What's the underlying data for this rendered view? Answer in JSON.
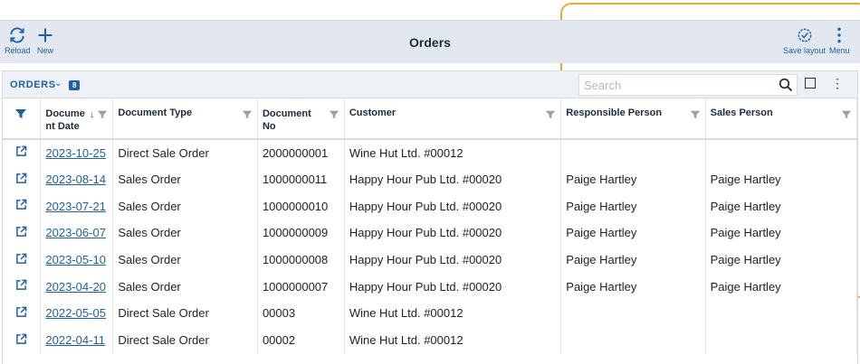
{
  "toolbar": {
    "reload_label": "Reload",
    "new_label": "New",
    "title": "Orders",
    "save_layout_label": "Save layout",
    "menu_label": "Menu"
  },
  "panel": {
    "label": "ORDERS",
    "count": "8",
    "search_placeholder": "Search"
  },
  "columns": [
    "Docume nt Date",
    "Document Type",
    "Document No",
    "Customer",
    "Responsible Person",
    "Sales Person"
  ],
  "rows": [
    {
      "date": "2023-10-25",
      "type": "Direct Sale Order",
      "no": "2000000001",
      "customer": "Wine Hut Ltd. #00012",
      "responsible": "",
      "sales": ""
    },
    {
      "date": "2023-08-14",
      "type": "Sales Order",
      "no": "1000000011",
      "customer": "Happy Hour Pub Ltd. #00020",
      "responsible": "Paige Hartley",
      "sales": "Paige Hartley"
    },
    {
      "date": "2023-07-21",
      "type": "Sales Order",
      "no": "1000000010",
      "customer": "Happy Hour Pub Ltd. #00020",
      "responsible": "Paige Hartley",
      "sales": "Paige Hartley"
    },
    {
      "date": "2023-06-07",
      "type": "Sales Order",
      "no": "1000000009",
      "customer": "Happy Hour Pub Ltd. #00020",
      "responsible": "Paige Hartley",
      "sales": "Paige Hartley"
    },
    {
      "date": "2023-05-10",
      "type": "Sales Order",
      "no": "1000000008",
      "customer": "Happy Hour Pub Ltd. #00020",
      "responsible": "Paige Hartley",
      "sales": "Paige Hartley"
    },
    {
      "date": "2023-04-20",
      "type": "Sales Order",
      "no": "1000000007",
      "customer": "Happy Hour Pub Ltd. #00020",
      "responsible": "Paige Hartley",
      "sales": "Paige Hartley"
    },
    {
      "date": "2022-05-05",
      "type": "Direct Sale Order",
      "no": "00003",
      "customer": "Wine Hut Ltd. #00012",
      "responsible": "",
      "sales": ""
    },
    {
      "date": "2022-04-11",
      "type": "Direct Sale Order",
      "no": "00002",
      "customer": "Wine Hut Ltd. #00012",
      "responsible": "",
      "sales": ""
    }
  ],
  "colors": {
    "accent": "#1f5fa8",
    "highlight_frame": "#f4a62a",
    "toolbar_bg": "#e3e8f0"
  }
}
